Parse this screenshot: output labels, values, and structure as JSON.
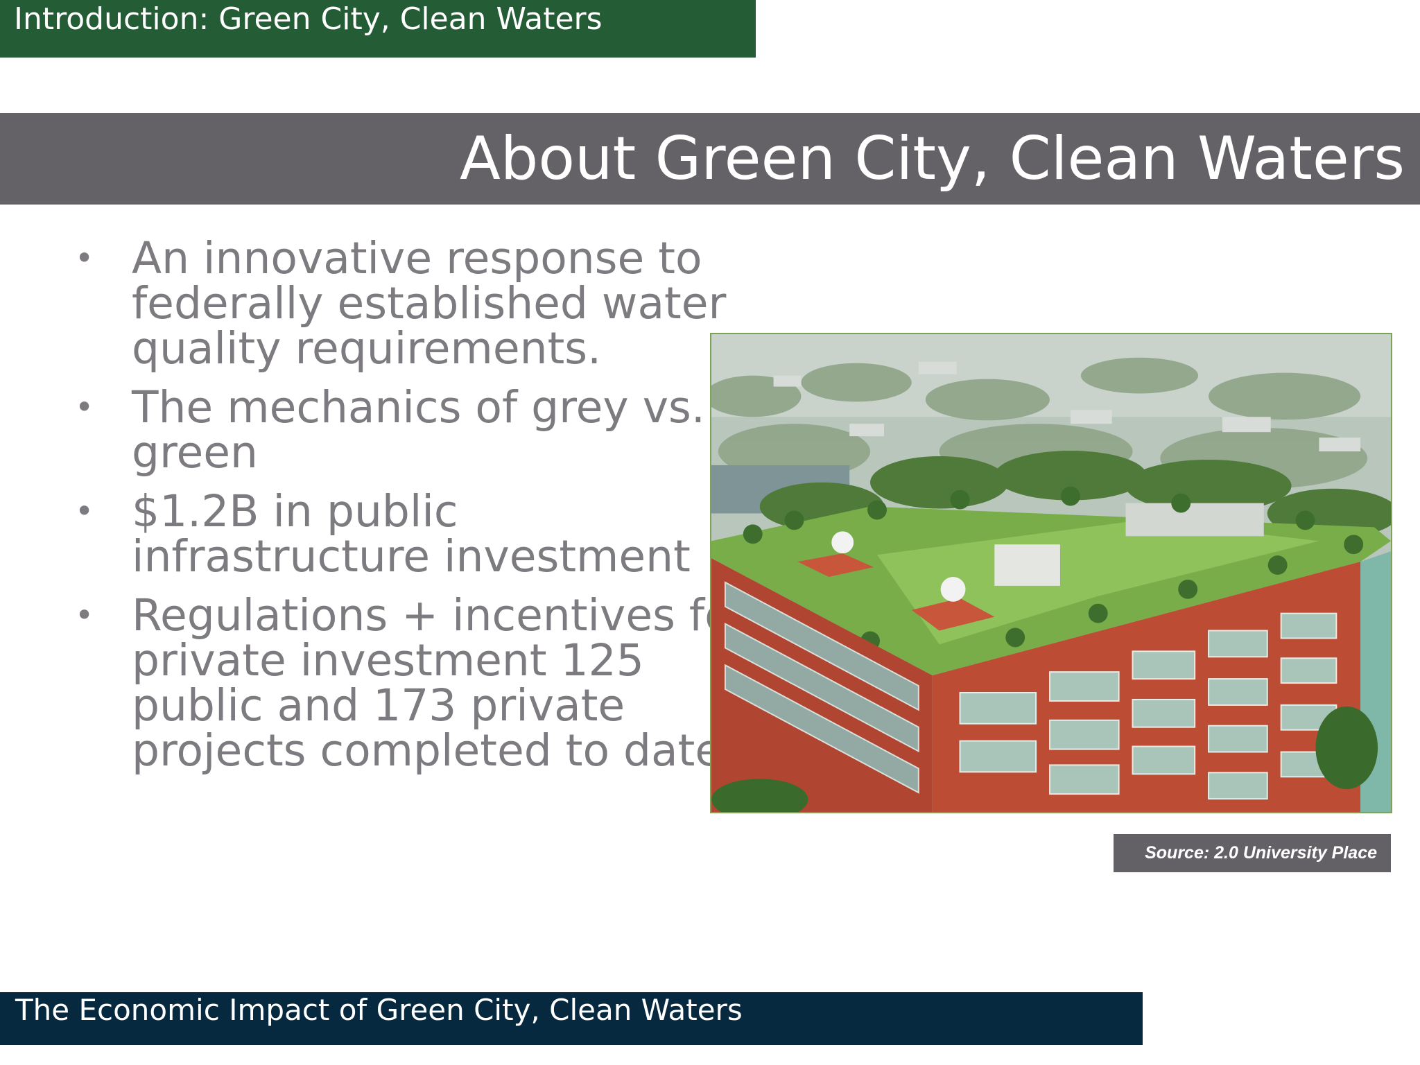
{
  "header": {
    "section_label": "Introduction: Green City, Clean Waters",
    "section_color": "#245c36"
  },
  "slide": {
    "title": "About Green City, Clean Waters",
    "title_bar_color": "#646266",
    "bullets": [
      "An innovative response to federally established water quality requirements.",
      "The mechanics of grey vs. green",
      "$1.2B in public infrastructure investment",
      "Regulations + incentives for private investment 125 public and 173 private projects completed to date."
    ],
    "bullet_lines": [
      [
        "An innovative response to",
        "federally established water",
        "quality requirements."
      ],
      [
        "The mechanics of grey vs.",
        "green"
      ],
      [
        "$1.2B in public",
        "infrastructure investment"
      ],
      [
        "Regulations + incentives for",
        "private investment 125",
        "public and 173 private",
        "projects completed to date."
      ]
    ],
    "bullet_symbol": "•",
    "image": {
      "subject": "green-roof-building-photo",
      "source_label": "Source: 2.0 University Place"
    }
  },
  "footer": {
    "presentation_title": "The Economic Impact of Green City, Clean Waters",
    "bar_color": "#062940"
  }
}
